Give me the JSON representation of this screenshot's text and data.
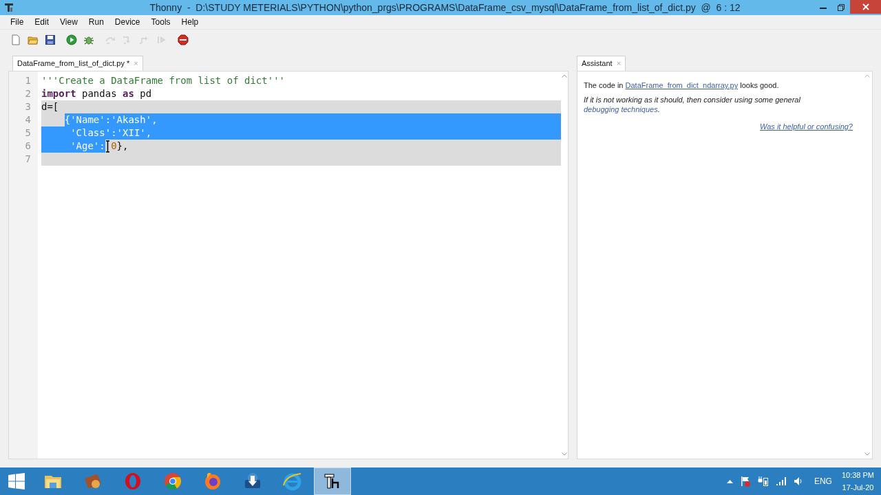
{
  "window": {
    "title": "Thonny  -  D:\\STUDY METERIALS\\PYTHON\\python_prgs\\PROGRAMS\\DataFrame_csv_mysql\\DataFrame_from_list_of_dict.py  @  6 : 12"
  },
  "menu": [
    "File",
    "Edit",
    "View",
    "Run",
    "Device",
    "Tools",
    "Help"
  ],
  "toolbar": [
    {
      "kind": "new",
      "disabled": false
    },
    {
      "kind": "open",
      "disabled": false
    },
    {
      "kind": "save",
      "disabled": false
    },
    {
      "kind": "run",
      "disabled": false
    },
    {
      "kind": "debug",
      "disabled": false
    },
    {
      "kind": "step_over",
      "disabled": true
    },
    {
      "kind": "step_into",
      "disabled": true
    },
    {
      "kind": "step_out",
      "disabled": true
    },
    {
      "kind": "resume",
      "disabled": true
    },
    {
      "kind": "stop",
      "disabled": false
    }
  ],
  "editor": {
    "tab": {
      "label": "DataFrame_from_list_of_dict.py *",
      "close": "×",
      "selected": true
    },
    "lines": [
      {
        "number": "1",
        "band": false,
        "selected_eol": false,
        "segments": [
          {
            "text": "'''Create a DataFrame from list of dict'''",
            "kind": "string",
            "selected": false
          }
        ]
      },
      {
        "number": "2",
        "band": false,
        "selected_eol": false,
        "segments": [
          {
            "text": "import",
            "kind": "keyword",
            "selected": false
          },
          {
            "text": " pandas ",
            "kind": "plain",
            "selected": false
          },
          {
            "text": "as",
            "kind": "keyword",
            "selected": false
          },
          {
            "text": " pd",
            "kind": "plain",
            "selected": false
          }
        ]
      },
      {
        "number": "3",
        "band": true,
        "selected_eol": false,
        "segments": [
          {
            "text": "d=[",
            "kind": "plain",
            "selected": false
          }
        ]
      },
      {
        "number": "4",
        "band": true,
        "selected_eol": true,
        "indented": true,
        "segments": [
          {
            "text": "{",
            "kind": "plain",
            "selected": true
          },
          {
            "text": "'Name'",
            "kind": "string",
            "selected": true
          },
          {
            "text": ":",
            "kind": "plain",
            "selected": true
          },
          {
            "text": "'Akash'",
            "kind": "string",
            "selected": true
          },
          {
            "text": ",",
            "kind": "plain",
            "selected": true
          }
        ]
      },
      {
        "number": "5",
        "band": true,
        "selected_eol": true,
        "segments": [
          {
            "text": "     'Class'",
            "kind": "string",
            "selected": true
          },
          {
            "text": ":",
            "kind": "plain",
            "selected": true
          },
          {
            "text": "'XII'",
            "kind": "string",
            "selected": true
          },
          {
            "text": ",",
            "kind": "plain",
            "selected": true
          }
        ]
      },
      {
        "number": "6",
        "band": true,
        "selected_eol": false,
        "pointer": true,
        "segments": [
          {
            "text": "     'Age'",
            "kind": "string",
            "selected": true
          },
          {
            "text": ":",
            "kind": "plain",
            "selected": true
          },
          {
            "text": "0",
            "kind": "number",
            "selected": false
          },
          {
            "text": "},",
            "kind": "plain",
            "selected": false
          }
        ]
      },
      {
        "number": "7",
        "band": true,
        "selected_eol": false
      }
    ]
  },
  "assistant": {
    "tab": {
      "label": "Assistant",
      "close": "×",
      "selected": true
    },
    "paragraphs": [
      {
        "italic": false,
        "segments": [
          {
            "kind": "text",
            "text": "The code in "
          },
          {
            "kind": "link",
            "text": "DataFrame_from_dict_ndarray.py",
            "underline": true
          },
          {
            "kind": "text",
            "text": " looks good."
          }
        ]
      },
      {
        "italic": true,
        "segments": [
          {
            "kind": "text",
            "text": "If it is not working as it should, then consider using some general "
          },
          {
            "kind": "link",
            "text": "debugging techniques",
            "underline": false
          },
          {
            "kind": "text",
            "text": "."
          }
        ]
      }
    ],
    "feedback_link": "Was it helpful or confusing?"
  },
  "taskbar": {
    "apps": [
      {
        "kind": "folder",
        "active": false
      },
      {
        "kind": "media",
        "active": false
      },
      {
        "kind": "ring",
        "active": false
      },
      {
        "kind": "chrome",
        "active": false
      },
      {
        "kind": "fox",
        "active": false
      },
      {
        "kind": "arrow",
        "active": false
      },
      {
        "kind": "ie",
        "active": false
      },
      {
        "kind": "thonny",
        "active": true
      }
    ],
    "language": "ENG",
    "time": "10:38 PM",
    "date": "17-Jul-20"
  }
}
